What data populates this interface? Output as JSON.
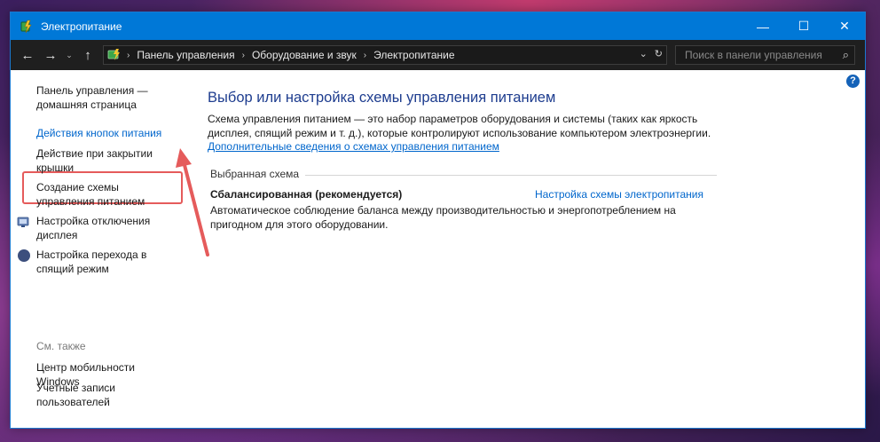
{
  "window": {
    "title": "Электропитание",
    "controls": {
      "minimize": "—",
      "maximize": "☐",
      "close": "✕"
    }
  },
  "navbar": {
    "back": "←",
    "forward": "→",
    "recent": "⌄",
    "up": "↑",
    "breadcrumbs": [
      "Панель управления",
      "Оборудование и звук",
      "Электропитание"
    ],
    "separator": "›",
    "dropdown": "⌄",
    "refresh": "↻",
    "search_placeholder": "Поиск в панели управления",
    "search_icon": "⌕"
  },
  "help": "?",
  "sidebar": {
    "home": "Панель управления — домашняя страница",
    "items": [
      "Действия кнопок питания",
      "Действие при закрытии крышки",
      "Создание схемы управления питанием",
      "Настройка отключения дисплея",
      "Настройка перехода в спящий режим"
    ],
    "see_also": "См. также",
    "see_also_items": [
      "Центр мобильности Windows",
      "Учетные записи пользователей"
    ]
  },
  "main": {
    "title": "Выбор или настройка схемы управления питанием",
    "description": "Схема управления питанием — это набор параметров оборудования и системы (таких как яркость дисплея, спящий режим и т. д.), которые контролируют использование компьютером электроэнергии.",
    "more_link": "Дополнительные сведения о схемах управления питанием",
    "selected_label": "Выбранная схема",
    "scheme_name": "Сбалансированная (рекомендуется)",
    "scheme_link": "Настройка схемы электропитания",
    "scheme_desc": "Автоматическое соблюдение баланса между производительностью и энергопотреблением на пригодном для этого оборудовании."
  },
  "colors": {
    "titlebar": "#0078d7",
    "navbar": "#1f1f1f",
    "link": "#0066cc",
    "heading": "#1e3d8f",
    "annotation": "#e55b5b"
  }
}
